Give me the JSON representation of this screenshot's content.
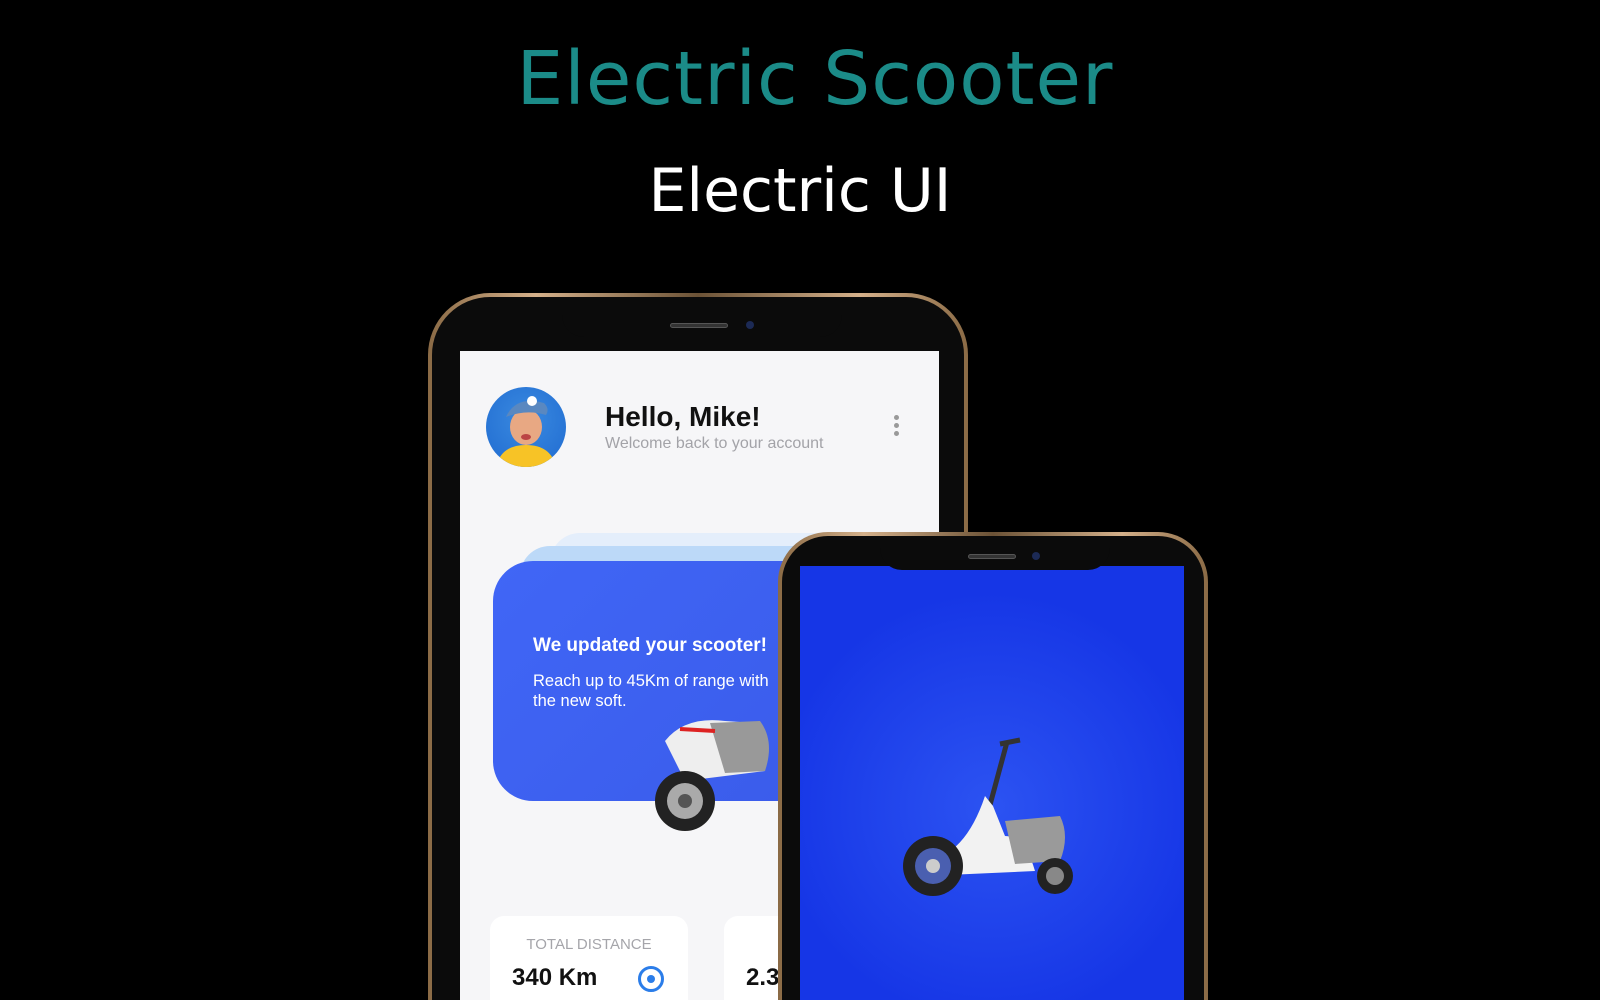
{
  "header": {
    "title": "Electric Scooter",
    "subtitle": "Electric UI",
    "title_color": "#1b8b88"
  },
  "phone_home": {
    "greeting": "Hello, Mike!",
    "welcome": "Welcome back to your account",
    "menu_icon": "more-vertical-icon",
    "banner": {
      "title": "We updated your scooter!",
      "text": "Reach up to 45Km of range with the new soft.",
      "color": "#4066f6"
    },
    "stats": [
      {
        "label": "TOTAL DISTANCE",
        "value": "340 Km",
        "icon": "target-icon"
      },
      {
        "label": "",
        "value": "2.3"
      }
    ]
  },
  "phone_splash": {
    "background": "#1a3de8"
  }
}
